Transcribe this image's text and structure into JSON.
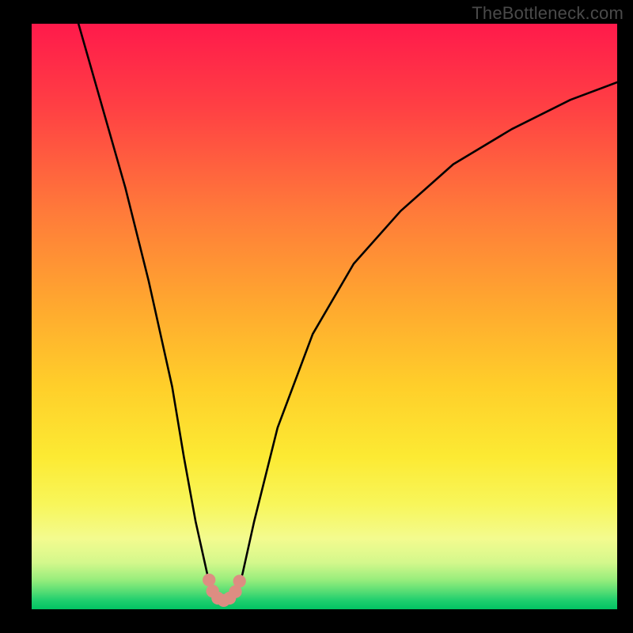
{
  "watermark": "TheBottleneck.com",
  "chart_data": {
    "type": "line",
    "title": "",
    "xlabel": "",
    "ylabel": "",
    "xlim": [
      0,
      100
    ],
    "ylim": [
      0,
      100
    ],
    "grid": false,
    "legend": false,
    "annotations": [],
    "series": [
      {
        "name": "curve",
        "color": "#000000",
        "x": [
          8,
          12,
          16,
          20,
          24,
          26,
          28,
          30,
          31,
          32,
          33,
          34,
          35,
          36,
          38,
          42,
          48,
          55,
          63,
          72,
          82,
          92,
          100
        ],
        "y": [
          100,
          86,
          72,
          56,
          38,
          26,
          15,
          6,
          3,
          1.5,
          1.0,
          1.5,
          3,
          6,
          15,
          31,
          47,
          59,
          68,
          76,
          82,
          87,
          90
        ]
      }
    ],
    "markers": [
      {
        "x": 30.3,
        "y": 5.0,
        "r": 1.1,
        "color": "#dd8d82"
      },
      {
        "x": 30.9,
        "y": 3.1,
        "r": 1.1,
        "color": "#dd8d82"
      },
      {
        "x": 31.8,
        "y": 1.9,
        "r": 1.1,
        "color": "#dd8d82"
      },
      {
        "x": 32.8,
        "y": 1.5,
        "r": 1.1,
        "color": "#dd8d82"
      },
      {
        "x": 33.8,
        "y": 1.9,
        "r": 1.1,
        "color": "#dd8d82"
      },
      {
        "x": 34.8,
        "y": 3.0,
        "r": 1.1,
        "color": "#dd8d82"
      },
      {
        "x": 35.5,
        "y": 4.8,
        "r": 1.1,
        "color": "#dd8d82"
      }
    ],
    "gradient_stops": [
      {
        "pct": 0,
        "color": "#ff1a4b"
      },
      {
        "pct": 14,
        "color": "#ff3f44"
      },
      {
        "pct": 32,
        "color": "#ff7a3a"
      },
      {
        "pct": 48,
        "color": "#ffa82f"
      },
      {
        "pct": 62,
        "color": "#ffcf2a"
      },
      {
        "pct": 74,
        "color": "#fcea33"
      },
      {
        "pct": 82,
        "color": "#f8f65a"
      },
      {
        "pct": 88,
        "color": "#f3fb8f"
      },
      {
        "pct": 92,
        "color": "#d4f88c"
      },
      {
        "pct": 95,
        "color": "#97ed7c"
      },
      {
        "pct": 97,
        "color": "#55dd74"
      },
      {
        "pct": 98.5,
        "color": "#1fce6e"
      },
      {
        "pct": 100,
        "color": "#02c263"
      }
    ]
  }
}
